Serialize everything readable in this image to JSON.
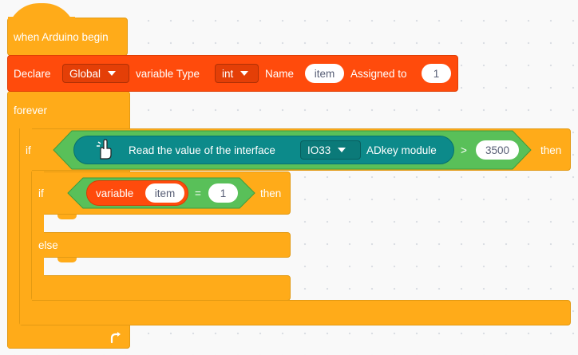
{
  "hat": {
    "label": "when Arduino begin"
  },
  "declare": {
    "label": "Declare",
    "scope": "Global",
    "type_label": "variable Type",
    "type": "int",
    "name_label": "Name",
    "name": "item",
    "assigned_label": "Assigned to",
    "value": "1"
  },
  "forever": {
    "label": "forever"
  },
  "outer_if": {
    "label": "if",
    "read_label": "Read the value of the interface",
    "port": "IO33",
    "module": "ADkey module",
    "operator": ">",
    "threshold": "3500",
    "then_label": "then"
  },
  "inner_if": {
    "label": "if",
    "var_label": "variable",
    "var_name": "item",
    "operator": "=",
    "compare": "1",
    "then_label": "then",
    "else_label": "else"
  },
  "colors": {
    "control": "#ffab19",
    "variable": "#ff4b0c",
    "operator": "#59c059",
    "sensor": "#0c8a8a"
  },
  "icons": {
    "sensor": "pointing-hand-icon",
    "loop": "loop-arrow-icon"
  }
}
